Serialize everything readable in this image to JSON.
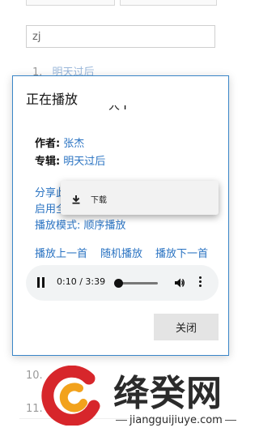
{
  "search": {
    "value": "zj"
  },
  "list": [
    {
      "number": "1.",
      "title": "明天过后"
    },
    {
      "number": "10.",
      "title": ""
    },
    {
      "number": "11.",
      "title": ""
    }
  ],
  "dialog": {
    "title": "正在播放",
    "song_title_partial": "人 I",
    "artist_label": "作者:",
    "artist": "张杰",
    "album_label": "专辑:",
    "album": "明天过后",
    "share_link_partial": "分享此",
    "enable_link_partial": "启用全",
    "play_mode": "播放模式: 顺序播放",
    "prev_label": "播放上一首",
    "random_label": "随机播放",
    "next_label": "播放下一首",
    "close_label": "关闭"
  },
  "player": {
    "time": "0:10 / 3:39",
    "progress": 0.0457
  },
  "context_menu": {
    "download_label": "下载"
  },
  "watermark": {
    "brand": "绛癸网",
    "url": "jiangguijiuye.com"
  },
  "colors": {
    "link": "#2a73c2",
    "dialog_border": "#3a86c8",
    "player_bg": "#f1f3f4",
    "close_btn_bg": "#e4e4e4",
    "logo_red": "#d7262b",
    "logo_orange": "#f2a21c"
  }
}
